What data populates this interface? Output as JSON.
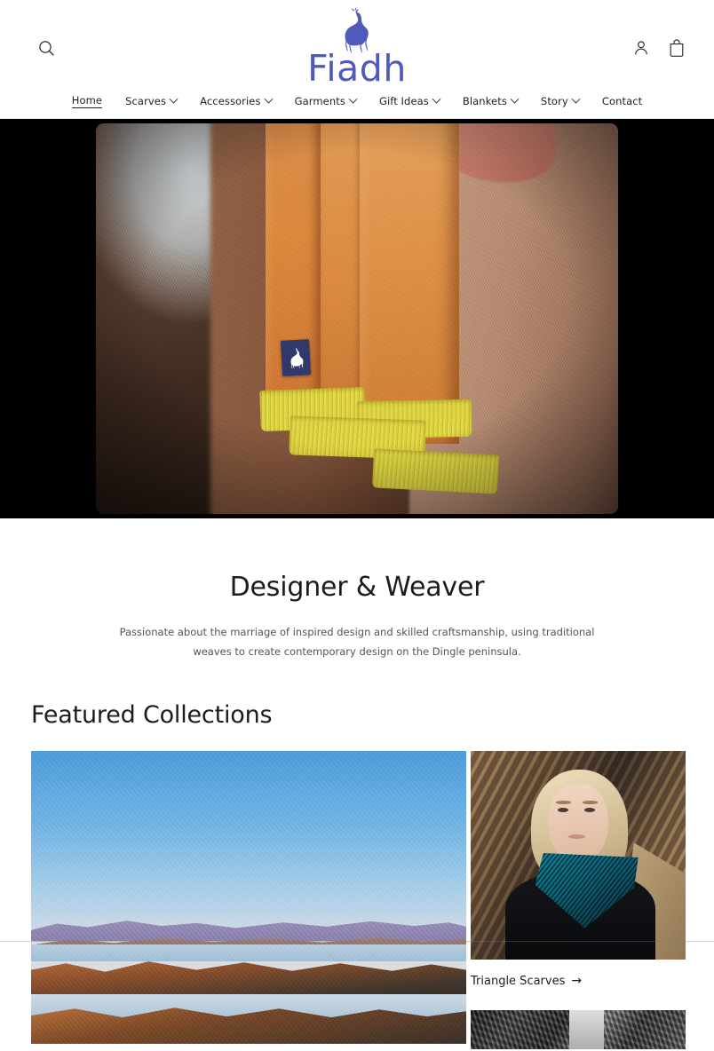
{
  "brand": {
    "name": "Fiadh",
    "logo_icon": "deer-icon",
    "color": "#4e5bbd"
  },
  "header": {
    "search_icon": "search-icon",
    "account_icon": "account-person-icon",
    "cart_icon": "shopping-bag-icon"
  },
  "nav": {
    "items": [
      {
        "label": "Home",
        "has_dropdown": false,
        "active": true
      },
      {
        "label": "Scarves",
        "has_dropdown": true,
        "active": false
      },
      {
        "label": "Accessories",
        "has_dropdown": true,
        "active": false
      },
      {
        "label": "Garments",
        "has_dropdown": true,
        "active": false
      },
      {
        "label": "Gift Ideas",
        "has_dropdown": true,
        "active": false
      },
      {
        "label": "Blankets",
        "has_dropdown": true,
        "active": false
      },
      {
        "label": "Story",
        "has_dropdown": true,
        "active": false
      },
      {
        "label": "Contact",
        "has_dropdown": false,
        "active": false
      }
    ]
  },
  "hero": {
    "media_type": "video",
    "alt": "Orange handwoven scarf with yellow fringe and blue Fiadh deer label, worn over the arm"
  },
  "intro": {
    "heading": "Designer & Weaver",
    "body": "Passionate about the marriage of inspired design and skilled craftsmanship, using traditional weaves to create contemporary design on the Dingle peninsula."
  },
  "featured": {
    "heading": "Featured Collections",
    "cards": [
      {
        "image_alt": "Coastal landscape at sunrise with blue sky, distant purple mountains and rocky shoreline on the Dingle peninsula",
        "caption": "",
        "arrow": ""
      },
      {
        "image_alt": "Blonde woman in a black coat wearing a teal triangle scarf, standing against rock face",
        "caption": "Triangle Scarves",
        "arrow": "→"
      },
      {
        "image_alt": "Black and white photograph, partially visible",
        "caption": "",
        "arrow": ""
      }
    ]
  }
}
